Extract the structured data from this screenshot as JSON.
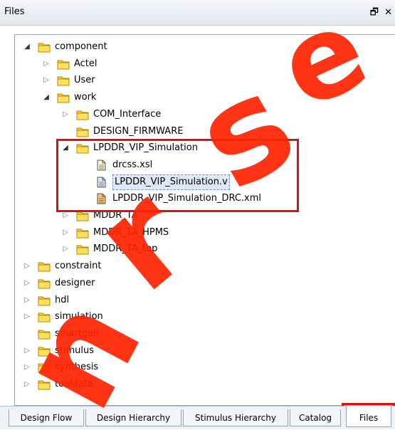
{
  "window": {
    "title": "Files",
    "controls": [
      "🗗",
      "✕"
    ]
  },
  "tree": [
    {
      "label": "component",
      "level": 0,
      "expander": "open",
      "icon": "folder-icon"
    },
    {
      "label": "Actel",
      "level": 1,
      "expander": "closed",
      "icon": "folder-icon"
    },
    {
      "label": "User",
      "level": 1,
      "expander": "closed",
      "icon": "folder-icon"
    },
    {
      "label": "work",
      "level": 1,
      "expander": "open",
      "icon": "folder-icon"
    },
    {
      "label": "COM_Interface",
      "level": 2,
      "expander": "closed",
      "icon": "folder-icon"
    },
    {
      "label": "DESIGN_FIRMWARE",
      "level": 2,
      "expander": "none",
      "icon": "folder-icon"
    },
    {
      "label": "LPDDR_VIP_Simulation",
      "level": 2,
      "expander": "open",
      "icon": "folder-icon"
    },
    {
      "label": "drcss.xsl",
      "level": 3,
      "expander": "none",
      "icon": "file-icon"
    },
    {
      "label": "LPDDR_VIP_Simulation.v",
      "level": 3,
      "expander": "none",
      "icon": "verilog-file-icon",
      "selected": true
    },
    {
      "label": "LPDDR_VIP_Simulation_DRC.xml",
      "level": 3,
      "expander": "none",
      "icon": "xml-file-icon"
    },
    {
      "label": "MDDR_TA",
      "level": 2,
      "expander": "closed",
      "icon": "folder-icon"
    },
    {
      "label": "MDDR_TA_HPMS",
      "level": 2,
      "expander": "closed",
      "icon": "folder-icon"
    },
    {
      "label": "MDDR_TA_top",
      "level": 2,
      "expander": "closed",
      "icon": "folder-icon"
    },
    {
      "label": "constraint",
      "level": 0,
      "expander": "closed",
      "icon": "folder-icon"
    },
    {
      "label": "designer",
      "level": 0,
      "expander": "closed",
      "icon": "folder-icon"
    },
    {
      "label": "hdl",
      "level": 0,
      "expander": "closed",
      "icon": "folder-icon"
    },
    {
      "label": "simulation",
      "level": 0,
      "expander": "closed",
      "icon": "folder-icon"
    },
    {
      "label": "smartgen",
      "level": 0,
      "expander": "none",
      "icon": "folder-icon"
    },
    {
      "label": "stimulus",
      "level": 0,
      "expander": "closed",
      "icon": "folder-icon"
    },
    {
      "label": "synthesis",
      "level": 0,
      "expander": "closed",
      "icon": "folder-icon"
    },
    {
      "label": "tooldata",
      "level": 0,
      "expander": "closed",
      "icon": "folder-icon"
    }
  ],
  "tabs": [
    {
      "label": "Design Flow"
    },
    {
      "label": "Design Hierarchy"
    },
    {
      "label": "Stimulus Hierarchy"
    },
    {
      "label": "Catalog"
    },
    {
      "label": "Files",
      "active": true
    }
  ],
  "colors": {
    "highlight": "#e01010",
    "folder": "#f2c200",
    "watermark": "#ff2200"
  }
}
